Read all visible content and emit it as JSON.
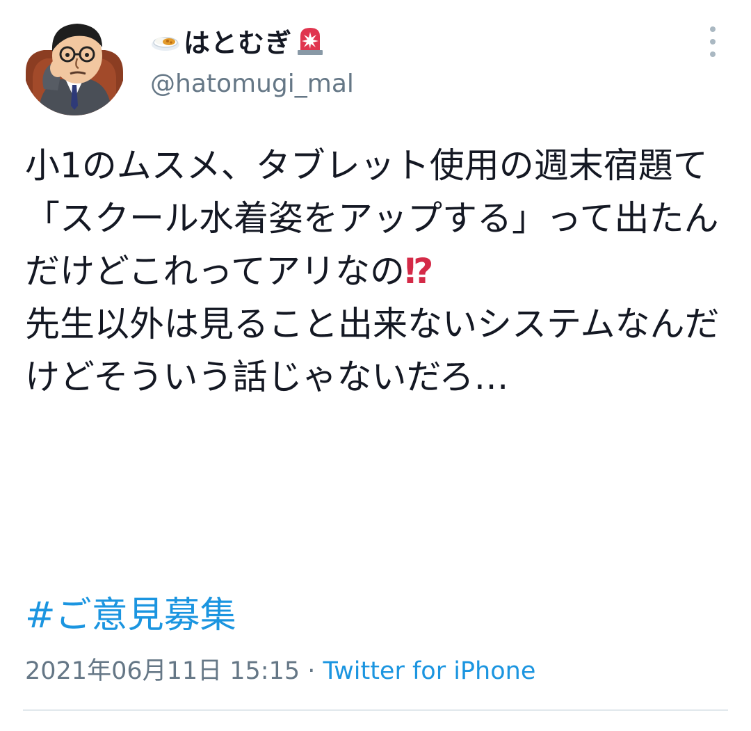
{
  "user": {
    "display_name": "はとむぎ",
    "handle": "@hatomugi_mal",
    "name_prefix_icon": "curry-rice-icon",
    "name_suffix_icon": "rotating-light-icon"
  },
  "tweet": {
    "text_part1": "小1のムスメ、タブレット使用の週末宿題て「スクール水着姿をアップする」って出たんだけどこれってアリなの",
    "interrobang": "⁉",
    "text_part2": "\n先生以外は見ること出来ないシステムなんだけどそういう話じゃないだろ…",
    "hashtag": "#ご意見募集",
    "timestamp": "2021年06月11日 15:15",
    "separator": " · ",
    "source": "Twitter for iPhone"
  },
  "icons": {
    "more": "more-vertical-icon"
  },
  "colors": {
    "text": "#141823",
    "secondary": "#657786",
    "link": "#1b95e0",
    "accent_red": "#d42a47",
    "divider": "#e1e8ed"
  }
}
